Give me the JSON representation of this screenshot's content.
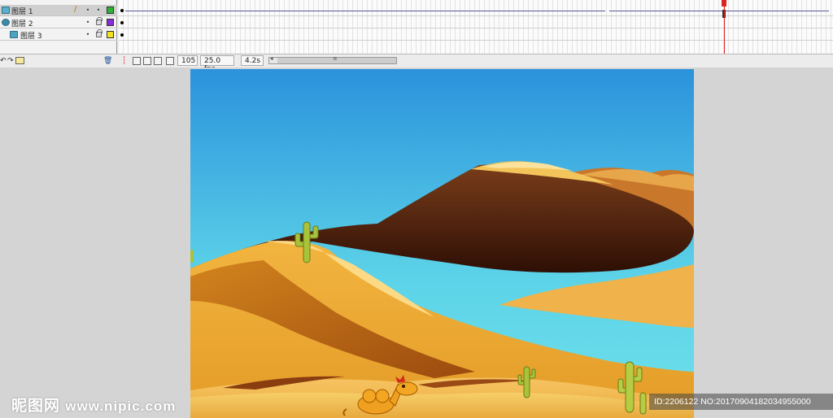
{
  "timeline": {
    "layers": [
      {
        "name": "图层 1",
        "color": "#2fb135"
      },
      {
        "name": "图层 2",
        "color": "#8a2bd6"
      },
      {
        "name": "图层 3",
        "color": "#f2e11e"
      }
    ],
    "footer": {
      "current_frame": "105",
      "frame_rate": "25.0 fps",
      "elapsed_time": "4.2s"
    }
  },
  "watermark": {
    "logo_text": "昵图网",
    "url_text": "www.nipic.com",
    "id_text": "ID:2206122 NO:20170904182034955000"
  }
}
